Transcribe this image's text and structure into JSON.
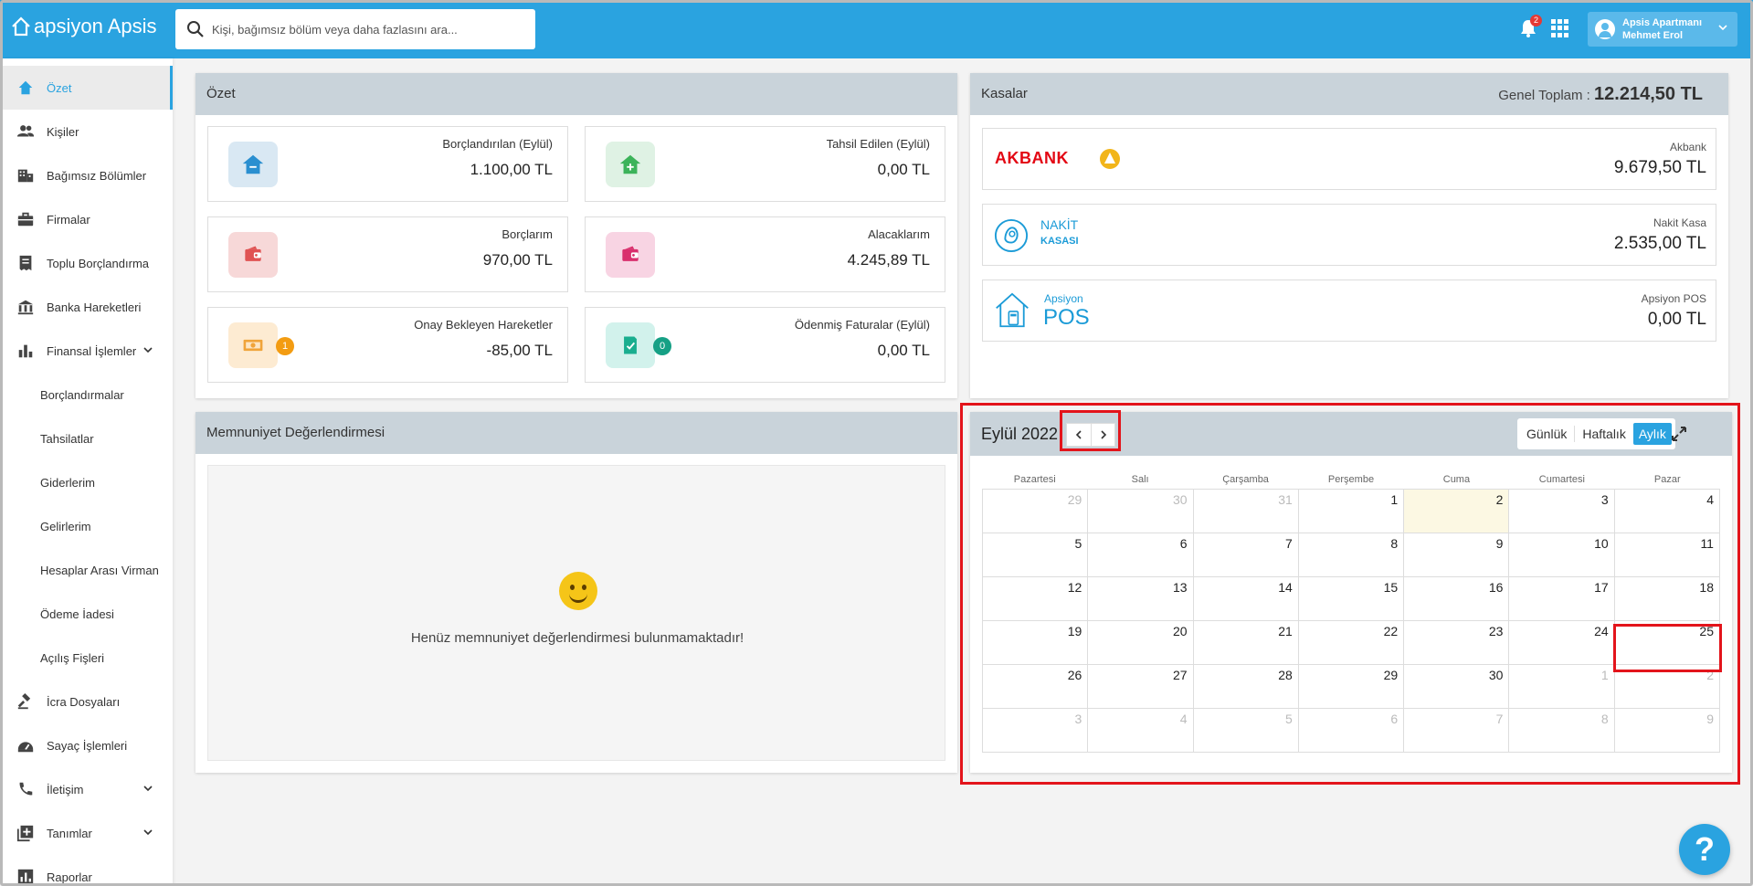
{
  "app": {
    "logo_text": "apsiyon Apsis"
  },
  "search": {
    "placeholder": "Kişi, bağımsız bölüm veya daha fazlasını ara..."
  },
  "notifications": {
    "count": "2"
  },
  "user": {
    "org": "Apsis Apartmanı",
    "name": "Mehmet Erol"
  },
  "sidebar": {
    "items": [
      {
        "label": "Özet",
        "icon": "home-icon"
      },
      {
        "label": "Kişiler",
        "icon": "people-icon"
      },
      {
        "label": "Bağımsız Bölümler",
        "icon": "building-icon"
      },
      {
        "label": "Firmalar",
        "icon": "briefcase-icon"
      },
      {
        "label": "Toplu Borçlandırma",
        "icon": "receipt-icon"
      },
      {
        "label": "Banka Hareketleri",
        "icon": "bank-icon"
      },
      {
        "label": "Finansal İşlemler",
        "icon": "bar-chart-icon"
      },
      {
        "label": "Borçlandırmalar"
      },
      {
        "label": "Tahsilatlar"
      },
      {
        "label": "Giderlerim"
      },
      {
        "label": "Gelirlerim"
      },
      {
        "label": "Hesaplar Arası Virman"
      },
      {
        "label": "Ödeme İadesi"
      },
      {
        "label": "Açılış Fişleri"
      },
      {
        "label": "İcra Dosyaları",
        "icon": "gavel-icon"
      },
      {
        "label": "Sayaç İşlemleri",
        "icon": "meter-icon"
      },
      {
        "label": "İletişim",
        "icon": "phone-icon"
      },
      {
        "label": "Tanımlar",
        "icon": "add-box-icon"
      },
      {
        "label": "Raporlar",
        "icon": "report-icon"
      }
    ]
  },
  "summary": {
    "title": "Özet",
    "cards": [
      {
        "title": "Borçlandırılan (Eylül)",
        "value": "1.100,00 TL",
        "icon": "house-minus-icon"
      },
      {
        "title": "Tahsil Edilen (Eylül)",
        "value": "0,00 TL",
        "icon": "house-plus-icon"
      },
      {
        "title": "Borçlarım",
        "value": "970,00 TL",
        "icon": "wallet-icon"
      },
      {
        "title": "Alacaklarım",
        "value": "4.245,89 TL",
        "icon": "wallet-icon"
      },
      {
        "title": "Onay Bekleyen Hareketler",
        "value": "-85,00 TL",
        "icon": "money-icon",
        "count": "1"
      },
      {
        "title": "Ödenmiş Faturalar (Eylül)",
        "value": "0,00 TL",
        "icon": "invoice-check-icon",
        "count": "0"
      }
    ]
  },
  "kasalar": {
    "title": "Kasalar",
    "total_label": "Genel Toplam :",
    "total_value": "12.214,50 TL",
    "items": [
      {
        "logo": "AKBANK",
        "title": "Akbank",
        "value": "9.679,50 TL"
      },
      {
        "logo_line1": "NAKİT",
        "logo_line2": "KASASI",
        "title": "Nakit Kasa",
        "value": "2.535,00 TL"
      },
      {
        "logo_line1": "Apsiyon",
        "logo_line2": "POS",
        "title": "Apsiyon POS",
        "value": "0,00 TL"
      }
    ]
  },
  "satisfaction": {
    "title": "Memnuniyet Değerlendirmesi",
    "empty_message": "Henüz memnuniyet değerlendirmesi bulunmamaktadır!"
  },
  "calendar": {
    "month_label": "Eylül 2022",
    "views": [
      "Günlük",
      "Haftalık",
      "Aylık"
    ],
    "active_view": "Aylık",
    "weekdays": [
      "Pazartesi",
      "Salı",
      "Çarşamba",
      "Perşembe",
      "Cuma",
      "Cumartesi",
      "Pazar"
    ],
    "days": [
      [
        "29",
        "30",
        "31",
        "1",
        "2",
        "3",
        "4"
      ],
      [
        "5",
        "6",
        "7",
        "8",
        "9",
        "10",
        "11"
      ],
      [
        "12",
        "13",
        "14",
        "15",
        "16",
        "17",
        "18"
      ],
      [
        "19",
        "20",
        "21",
        "22",
        "23",
        "24",
        "25"
      ],
      [
        "26",
        "27",
        "28",
        "29",
        "30",
        "1",
        "2"
      ],
      [
        "3",
        "4",
        "5",
        "6",
        "7",
        "8",
        "9"
      ]
    ],
    "today": "2"
  },
  "help": {
    "label": "?"
  },
  "colors": {
    "primary": "#2aa3e0",
    "highlight": "#e3141b",
    "akbank": "#e30613"
  }
}
